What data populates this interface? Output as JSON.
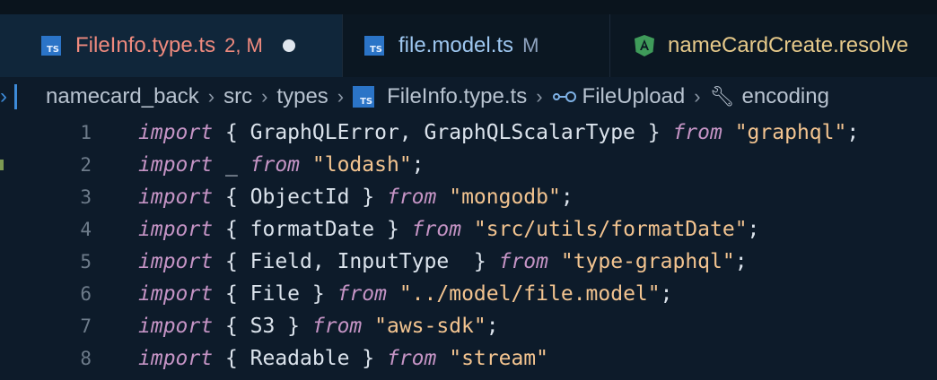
{
  "tabs": [
    {
      "label": "FileInfo.type.ts",
      "status": "2, M",
      "active": true,
      "icon": "typescript-icon",
      "label_color": "#ef8a7e",
      "status_color": "#ef8a7e"
    },
    {
      "label": "file.model.ts",
      "status": "M",
      "active": false,
      "icon": "typescript-icon",
      "label_color": "#9ec7f0",
      "status_color": "#8fa3bf"
    },
    {
      "label": "nameCardCreate.resolve",
      "status": "",
      "active": false,
      "icon": "angular-icon",
      "label_color": "#e6c98a",
      "status_color": ""
    }
  ],
  "icon_text": {
    "ts": "TS"
  },
  "breadcrumb": {
    "items": [
      "namecard_back",
      "src",
      "types",
      "FileInfo.type.ts",
      "FileUpload",
      "encoding"
    ]
  },
  "code": {
    "lines": [
      {
        "n": "1",
        "tokens": [
          [
            "kw",
            "import"
          ],
          [
            "pl",
            " { GraphQLError, GraphQLScalarType } "
          ],
          [
            "kw",
            "from"
          ],
          [
            "pl",
            " "
          ],
          [
            "str",
            "\"graphql\""
          ],
          [
            "pl",
            ";"
          ]
        ]
      },
      {
        "n": "2",
        "tokens": [
          [
            "kw",
            "import"
          ],
          [
            "pl",
            " _ "
          ],
          [
            "kw",
            "from"
          ],
          [
            "pl",
            " "
          ],
          [
            "str",
            "\"lodash\""
          ],
          [
            "pl",
            ";"
          ]
        ]
      },
      {
        "n": "3",
        "tokens": [
          [
            "kw",
            "import"
          ],
          [
            "pl",
            " { ObjectId } "
          ],
          [
            "kw",
            "from"
          ],
          [
            "pl",
            " "
          ],
          [
            "str",
            "\"mongodb\""
          ],
          [
            "pl",
            ";"
          ]
        ]
      },
      {
        "n": "4",
        "tokens": [
          [
            "kw",
            "import"
          ],
          [
            "pl",
            " { formatDate } "
          ],
          [
            "kw",
            "from"
          ],
          [
            "pl",
            " "
          ],
          [
            "str",
            "\"src/utils/formatDate\""
          ],
          [
            "pl",
            ";"
          ]
        ]
      },
      {
        "n": "5",
        "tokens": [
          [
            "kw",
            "import"
          ],
          [
            "pl",
            " { Field, InputType  } "
          ],
          [
            "kw",
            "from"
          ],
          [
            "pl",
            " "
          ],
          [
            "str",
            "\"type-graphql\""
          ],
          [
            "pl",
            ";"
          ]
        ]
      },
      {
        "n": "6",
        "tokens": [
          [
            "kw",
            "import"
          ],
          [
            "pl",
            " { File } "
          ],
          [
            "kw",
            "from"
          ],
          [
            "pl",
            " "
          ],
          [
            "str",
            "\"../model/file.model\""
          ],
          [
            "pl",
            ";"
          ]
        ]
      },
      {
        "n": "7",
        "tokens": [
          [
            "kw",
            "import"
          ],
          [
            "pl",
            " { S3 } "
          ],
          [
            "kw",
            "from"
          ],
          [
            "pl",
            " "
          ],
          [
            "str",
            "\"aws-sdk\""
          ],
          [
            "pl",
            ";"
          ]
        ]
      },
      {
        "n": "8",
        "tokens": [
          [
            "kw",
            "import"
          ],
          [
            "pl",
            " { Readable } "
          ],
          [
            "kw",
            "from"
          ],
          [
            "pl",
            " "
          ],
          [
            "str",
            "\"stream\""
          ]
        ]
      }
    ]
  }
}
